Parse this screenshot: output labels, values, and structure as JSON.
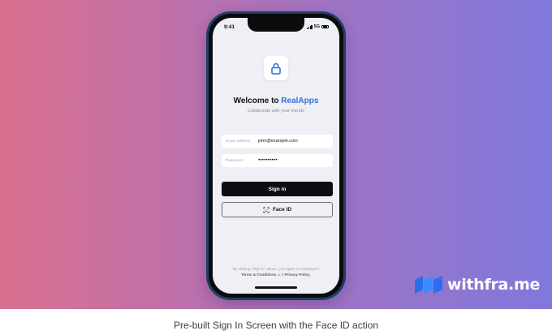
{
  "status": {
    "time": "9:41",
    "network": "5G"
  },
  "app": {
    "welcome_prefix": "Welcome to ",
    "brand_name": "RealApps",
    "subtitle": "Collaborate with your friends",
    "icon": "lock-icon"
  },
  "form": {
    "email_label": "Email address",
    "email_value": "john@example.com",
    "password_label": "Password",
    "password_value": "••••••••••"
  },
  "buttons": {
    "sign_in": "Sign in",
    "face_id": "Face ID"
  },
  "legal": {
    "line1": "By clicking \"Sign in\" above, you agree to RealApps's",
    "terms": "Terms & Conditions",
    "and": " and ",
    "privacy": "Privacy Policy",
    "end": "."
  },
  "branding": {
    "logo_text": "withfra.me"
  },
  "caption": "Pre-built Sign In Screen with the Face ID action",
  "colors": {
    "accent": "#2f6fe0",
    "button_dark": "#0e0e10",
    "gradient_start": "#d9708f",
    "gradient_end": "#8078dc"
  }
}
